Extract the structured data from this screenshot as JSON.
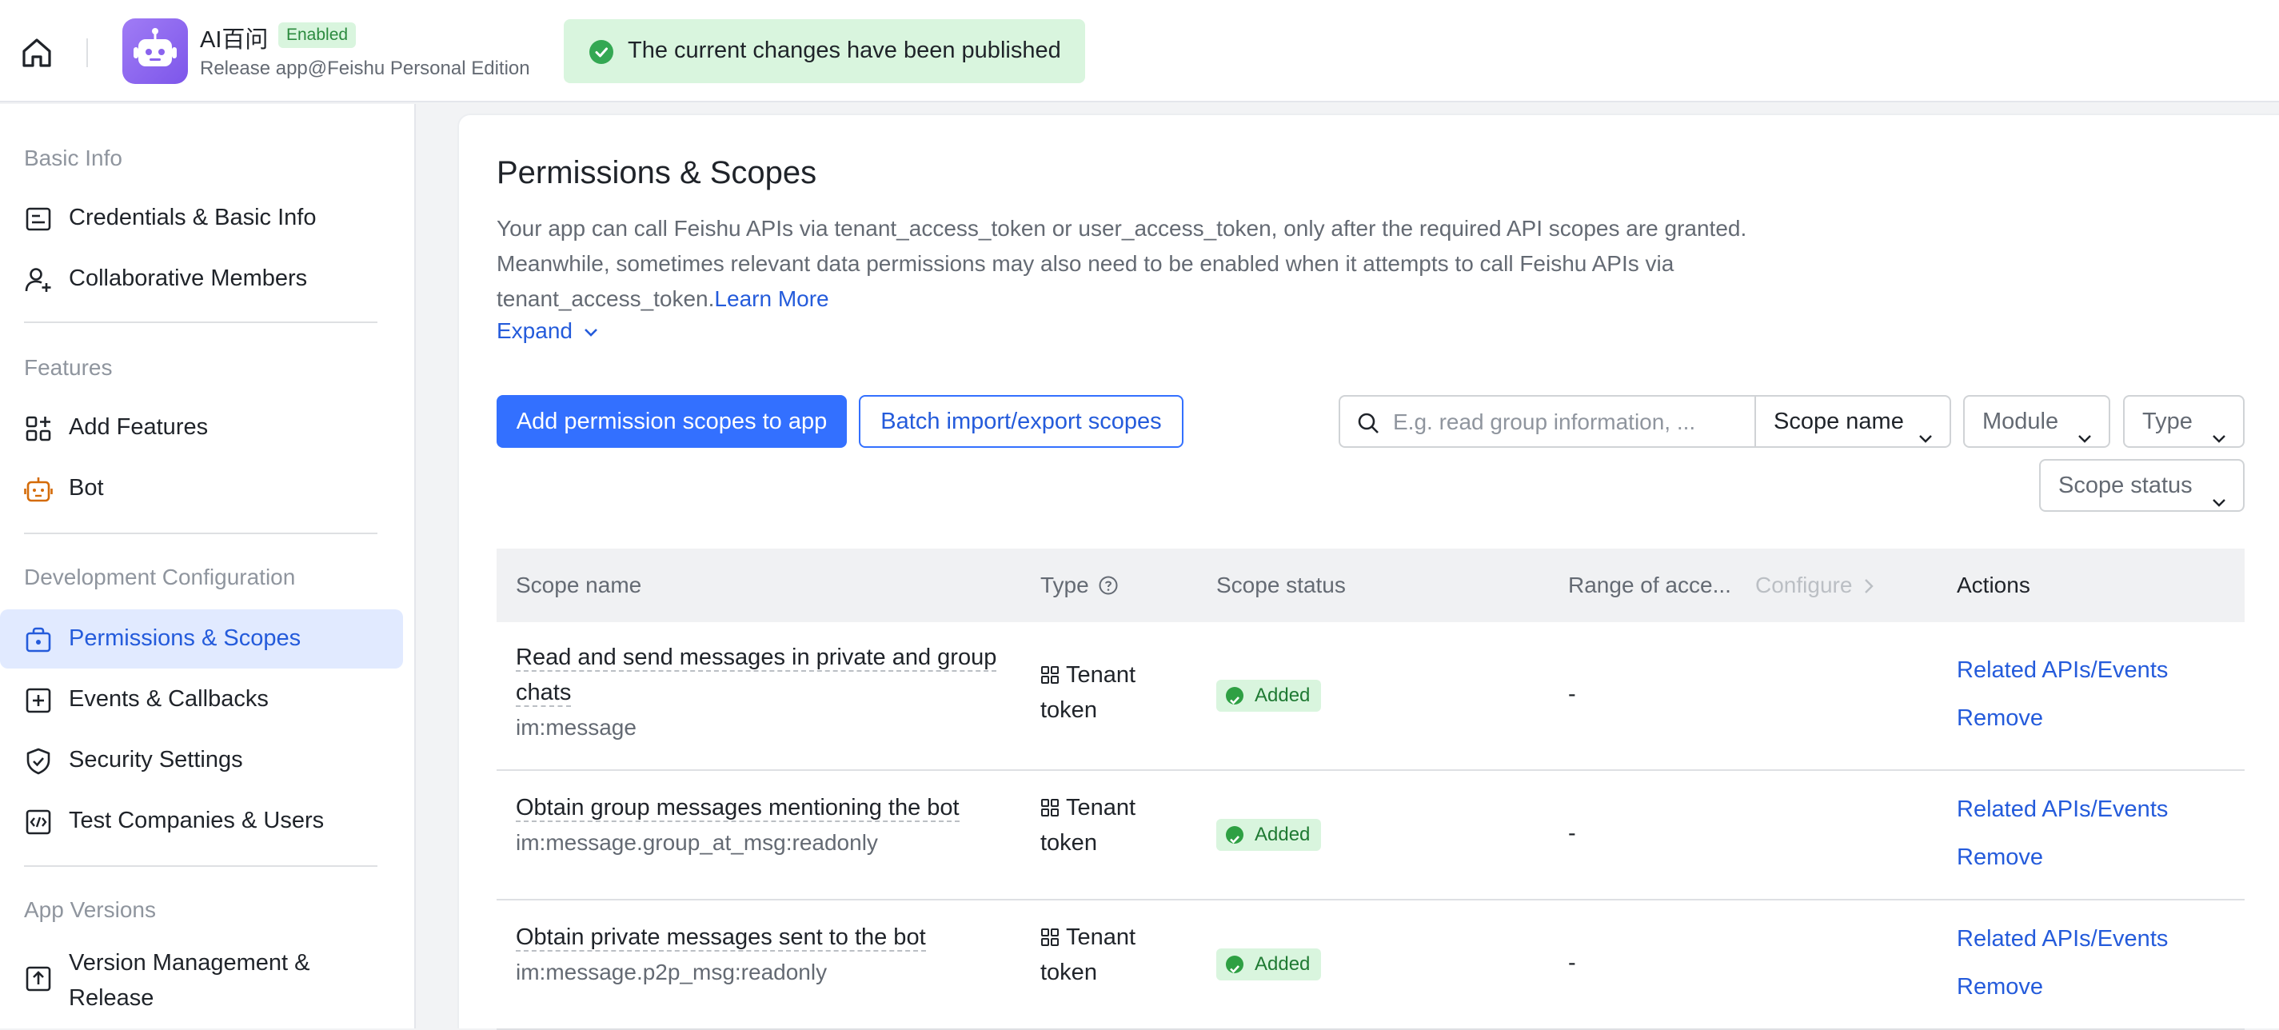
{
  "topbar": {
    "app_name": "AI百问",
    "status_badge": "Enabled",
    "app_subtitle": "Release app@Feishu Personal Edition",
    "toast": "The current changes have been published"
  },
  "sidebar": {
    "sections": [
      {
        "title": "Basic Info",
        "items": [
          {
            "label": "Credentials & Basic Info",
            "icon": "id-card-icon"
          },
          {
            "label": "Collaborative Members",
            "icon": "add-member-icon"
          }
        ]
      },
      {
        "title": "Features",
        "items": [
          {
            "label": "Add Features",
            "icon": "add-grid-icon"
          },
          {
            "label": "Bot",
            "icon": "bot-icon"
          }
        ]
      },
      {
        "title": "Development Configuration",
        "items": [
          {
            "label": "Permissions & Scopes",
            "icon": "permission-icon",
            "active": true
          },
          {
            "label": "Events & Callbacks",
            "icon": "event-icon"
          },
          {
            "label": "Security Settings",
            "icon": "shield-icon"
          },
          {
            "label": "Test Companies & Users",
            "icon": "code-icon"
          }
        ]
      },
      {
        "title": "App Versions",
        "items": [
          {
            "label": "Version Management & Release",
            "icon": "upload-icon"
          }
        ]
      }
    ]
  },
  "main": {
    "title": "Permissions & Scopes",
    "description": "Your app can call Feishu APIs via tenant_access_token or user_access_token, only after the required API scopes are granted. Meanwhile, sometimes relevant data permissions may also need to be enabled when it attempts to call Feishu APIs via tenant_access_token.",
    "learn_more": "Learn More",
    "expand": "Expand",
    "add_button": "Add permission scopes to app",
    "batch_button": "Batch import/export scopes",
    "search_placeholder": "E.g. read group information, ...",
    "filters": {
      "scope_name": "Scope name",
      "module": "Module",
      "type": "Type",
      "scope_status": "Scope status"
    },
    "table": {
      "headers": {
        "scope_name": "Scope name",
        "type": "Type",
        "scope_status": "Scope status",
        "range": "Range of acce...",
        "configure": "Configure",
        "actions": "Actions"
      },
      "rows": [
        {
          "title": "Read and send messages in private and group chats",
          "key": "im:message",
          "type": "Tenant token",
          "status": "Added",
          "range": "-",
          "action1": "Related APIs/Events",
          "action2": "Remove"
        },
        {
          "title": "Obtain group messages mentioning the bot",
          "key": "im:message.group_at_msg:readonly",
          "type": "Tenant token",
          "status": "Added",
          "range": "-",
          "action1": "Related APIs/Events",
          "action2": "Remove"
        },
        {
          "title": "Obtain private messages sent to the bot",
          "key": "im:message.p2p_msg:readonly",
          "type": "Tenant token",
          "status": "Added",
          "range": "-",
          "action1": "Related APIs/Events",
          "action2": "Remove"
        }
      ]
    }
  },
  "colors": {
    "accent": "#3370ff",
    "link": "#245bdb",
    "success_bg": "#d9f5de",
    "success": "#2ea043",
    "active_nav_bg": "#e1eaff"
  }
}
